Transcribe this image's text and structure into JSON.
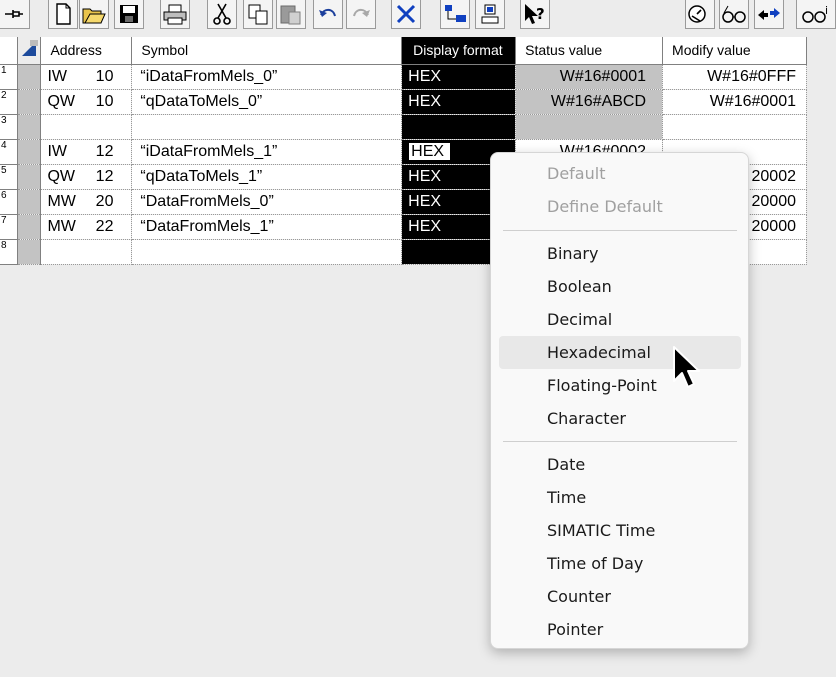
{
  "toolbar": {
    "buttons": [
      "pin-icon",
      "new-icon",
      "open-icon",
      "save-icon",
      "print-icon",
      "cut-icon",
      "copy-icon",
      "paste-icon",
      "undo-icon",
      "redo-icon",
      "delete-icon",
      "monitor-icon",
      "network-icon",
      "help-icon",
      "watch-icon",
      "glasses-icon",
      "modify-icon",
      "glasses-var-icon"
    ]
  },
  "table": {
    "headers": {
      "address": "Address",
      "symbol": "Symbol",
      "display_format": "Display format",
      "status_value": "Status value",
      "modify_value": "Modify value"
    },
    "rows": [
      {
        "num": "1",
        "addr_type": "IW",
        "addr_num": "10",
        "symbol": "“iDataFromMels_0”",
        "format": "HEX",
        "status": "W#16#0001",
        "modify": "W#16#0FFF"
      },
      {
        "num": "2",
        "addr_type": "QW",
        "addr_num": "10",
        "symbol": "“qDataToMels_0”",
        "format": "HEX",
        "status": "W#16#ABCD",
        "modify": "W#16#0001"
      },
      {
        "num": "3",
        "addr_type": "",
        "addr_num": "",
        "symbol": "",
        "format": "",
        "status": "",
        "modify": ""
      },
      {
        "num": "4",
        "addr_type": "IW",
        "addr_num": "12",
        "symbol": "“iDataFromMels_1”",
        "format": "HEX",
        "status": "W#16#0002",
        "modify": ""
      },
      {
        "num": "5",
        "addr_type": "QW",
        "addr_num": "12",
        "symbol": "“qDataToMels_1”",
        "format": "HEX",
        "status": "",
        "modify": "20002"
      },
      {
        "num": "6",
        "addr_type": "MW",
        "addr_num": "20",
        "symbol": "“DataFromMels_0”",
        "format": "HEX",
        "status": "",
        "modify": "20000"
      },
      {
        "num": "7",
        "addr_type": "MW",
        "addr_num": "22",
        "symbol": "“DataFromMels_1”",
        "format": "HEX",
        "status": "",
        "modify": "20000"
      },
      {
        "num": "8",
        "addr_type": "",
        "addr_num": "",
        "symbol": "",
        "format": "",
        "status": "",
        "modify": ""
      }
    ]
  },
  "context_menu": {
    "group1": [
      "Default",
      "Define Default"
    ],
    "group2": [
      "Binary",
      "Boolean",
      "Decimal",
      "Hexadecimal",
      "Floating-Point",
      "Character"
    ],
    "group3": [
      "Date",
      "Time",
      "SIMATIC Time",
      "Time of Day",
      "Counter",
      "Pointer"
    ],
    "hovered": "Hexadecimal"
  },
  "colors": {
    "selection": "#000000",
    "status_bg": "#c3c3c3",
    "menu_bg": "#f9f9f9",
    "menu_hover": "#e8e8e8"
  }
}
